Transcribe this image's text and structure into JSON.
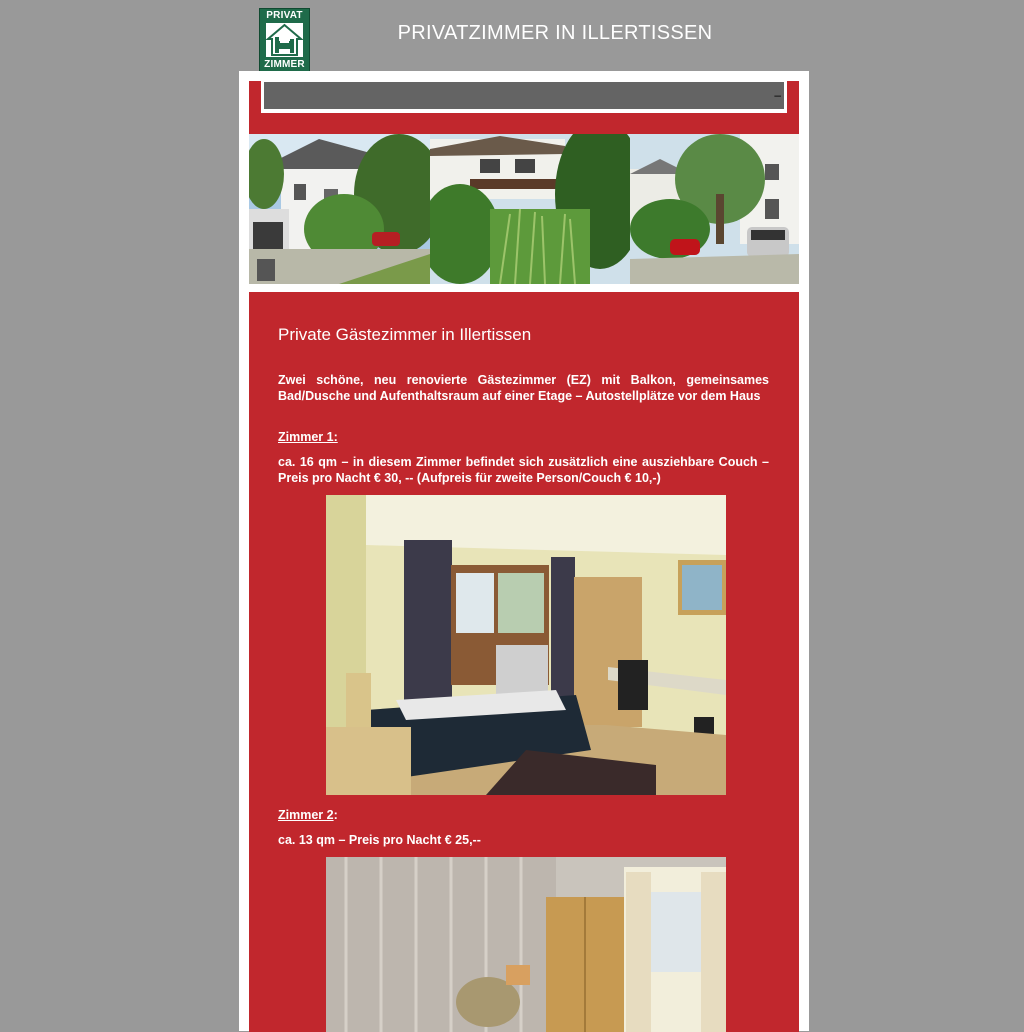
{
  "logo": {
    "line1": "PRIVAT",
    "line2": "ZIMMER",
    "icon": "bed-house-icon",
    "background": "#1f6b4a"
  },
  "site": {
    "title": "PRIVATZIMMER IN ILLERTISSEN"
  },
  "nav": {
    "marker": "–"
  },
  "colors": {
    "page_background": "#999999",
    "accent_red": "#c1272d",
    "nav_gray": "#646464"
  },
  "content": {
    "heading": "Private Gästezimmer in Illertissen",
    "intro": "Zwei schöne, neu renovierte Gästezimmer (EZ) mit Balkon, gemeinsames Bad/Dusche und Aufenthaltsraum auf einer Etage – Autostellplätze vor dem Haus",
    "room1": {
      "title": "Zimmer 1:",
      "description": "ca. 16 qm – in diesem Zimmer befindet sich zusätzlich eine ausziehbare Couch – Preis pro Nacht € 30, -- (Aufpreis für zweite Person/Couch € 10,-)"
    },
    "room2": {
      "title": "Zimmer 2",
      "title_suffix": ":",
      "description": "ca. 13 qm – Preis pro Nacht € 25,--"
    }
  }
}
